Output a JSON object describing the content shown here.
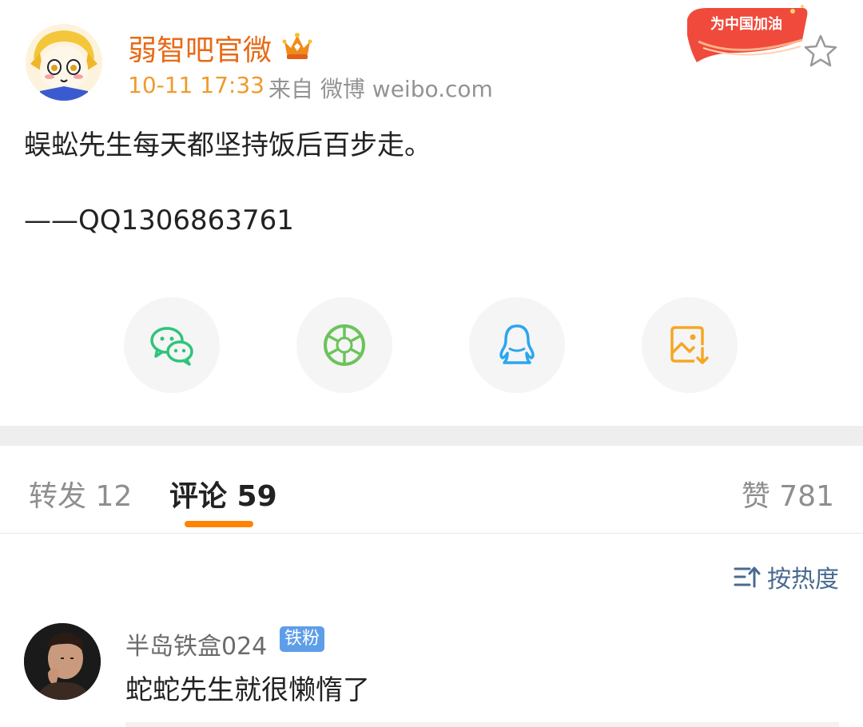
{
  "post": {
    "author": "弱智吧官微",
    "time": "10-11 17:33",
    "source": "来自 微博 weibo.com",
    "badge": "为中国加油",
    "line1": "蜈蚣先生每天都坚持饭后百步走。",
    "line2": "——QQ1306863761"
  },
  "icons": {
    "vip": "crown-vip-icon",
    "star": "star-outline-icon",
    "share": [
      "wechat-icon",
      "moments-icon",
      "qq-icon",
      "save-image-icon"
    ],
    "sort": "sort-icon"
  },
  "colors": {
    "accent": "#ff8200",
    "author_name": "#e86a17",
    "time": "#f09a2c",
    "wechat": "#2ec47a",
    "moments": "#6cc35a",
    "qq": "#2aa6f0",
    "save": "#f6a623",
    "sort": "#4a6a90",
    "badge": "#5e9ee8"
  },
  "tabs": {
    "repost": "转发 12",
    "comments": "评论 59",
    "likes": "赞 781"
  },
  "sort": {
    "label": "按热度"
  },
  "comment": {
    "user": "半岛铁盒024",
    "badge": "铁粉",
    "text": "蛇蛇先生就很懒惰了"
  }
}
